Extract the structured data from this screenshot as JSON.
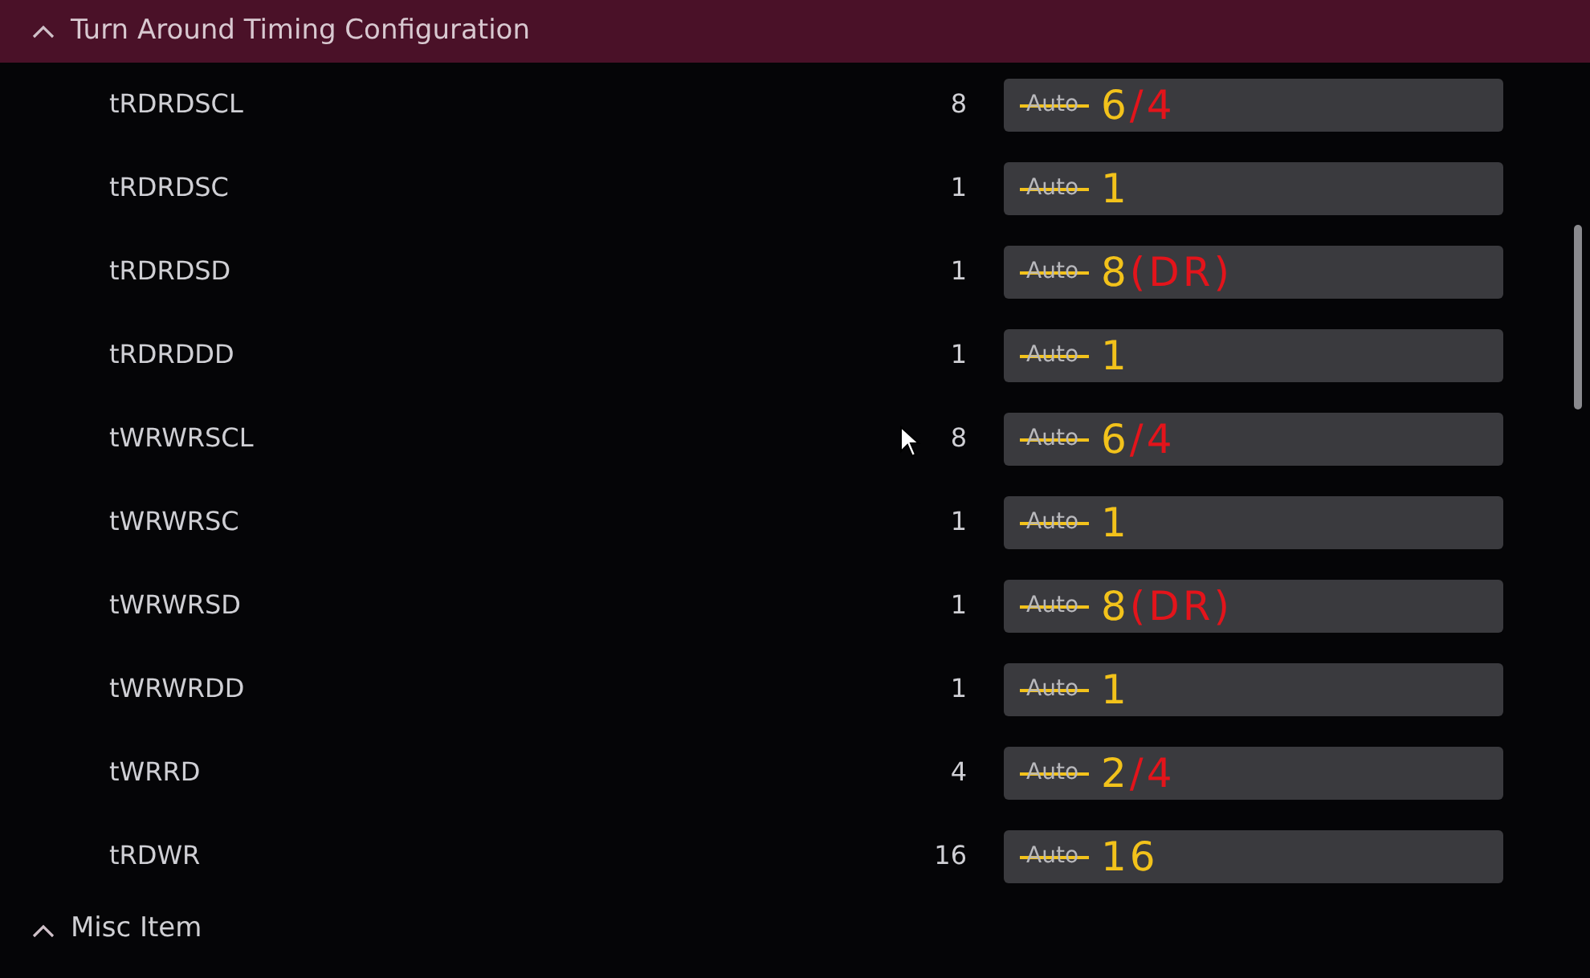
{
  "section": {
    "title": "Turn Around Timing Configuration",
    "expanded": true
  },
  "rows": [
    {
      "name": "tRDRDSCL",
      "current": "8",
      "value": "Auto",
      "struck": true,
      "note": [
        {
          "text": "6",
          "color": "#f2c21b"
        },
        {
          "text": "/4",
          "color": "#e3141b"
        }
      ]
    },
    {
      "name": "tRDRDSC",
      "current": "1",
      "value": "Auto",
      "struck": true,
      "note": [
        {
          "text": "1",
          "color": "#f2c21b"
        }
      ]
    },
    {
      "name": "tRDRDSD",
      "current": "1",
      "value": "Auto",
      "struck": true,
      "note": [
        {
          "text": "8",
          "color": "#f2c21b"
        },
        {
          "text": "(DR)",
          "color": "#e3141b"
        }
      ]
    },
    {
      "name": "tRDRDDD",
      "current": "1",
      "value": "Auto",
      "struck": true,
      "note": [
        {
          "text": "1",
          "color": "#f2c21b"
        }
      ]
    },
    {
      "name": "tWRWRSCL",
      "current": "8",
      "value": "Auto",
      "struck": true,
      "note": [
        {
          "text": "6",
          "color": "#f2c21b"
        },
        {
          "text": "/4",
          "color": "#e3141b"
        }
      ]
    },
    {
      "name": "tWRWRSC",
      "current": "1",
      "value": "Auto",
      "struck": true,
      "note": [
        {
          "text": "1",
          "color": "#f2c21b"
        }
      ]
    },
    {
      "name": "tWRWRSD",
      "current": "1",
      "value": "Auto",
      "struck": true,
      "note": [
        {
          "text": "8",
          "color": "#f2c21b"
        },
        {
          "text": "(DR)",
          "color": "#e3141b"
        }
      ]
    },
    {
      "name": "tWRWRDD",
      "current": "1",
      "value": "Auto",
      "struck": true,
      "note": [
        {
          "text": "1",
          "color": "#f2c21b"
        }
      ]
    },
    {
      "name": "tWRRD",
      "current": "4",
      "value": "Auto",
      "struck": true,
      "note": [
        {
          "text": "2",
          "color": "#f2c21b"
        },
        {
          "text": "/4",
          "color": "#e3141b"
        }
      ]
    },
    {
      "name": "tRDWR",
      "current": "16",
      "value": "Auto",
      "struck": true,
      "note": [
        {
          "text": "16",
          "color": "#f2c21b"
        }
      ]
    }
  ],
  "next_section": {
    "title": "Misc Item",
    "expanded": true
  }
}
